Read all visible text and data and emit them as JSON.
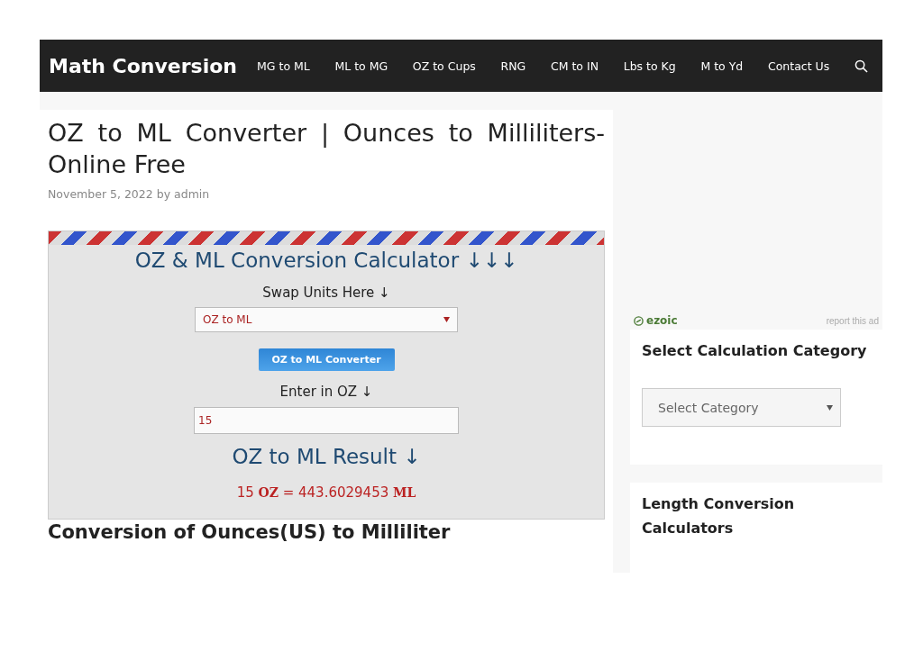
{
  "header": {
    "site_title": "Math Conversion",
    "nav": [
      {
        "label": "MG to ML"
      },
      {
        "label": "ML to MG"
      },
      {
        "label": "OZ to Cups"
      },
      {
        "label": "RNG"
      },
      {
        "label": "CM to IN"
      },
      {
        "label": "Lbs to Kg"
      },
      {
        "label": "M to Yd"
      },
      {
        "label": "Contact Us"
      }
    ]
  },
  "article": {
    "title": "OZ to ML Converter | Ounces to Milliliters-Online Free",
    "date": "November 5, 2022",
    "by": "by",
    "author": "admin",
    "calculator": {
      "heading": "OZ & ML Conversion Calculator ↓↓↓",
      "swap_label": "Swap Units Here ↓",
      "unit_select": {
        "value": "OZ to ML"
      },
      "button": "OZ to ML Converter",
      "input_label": "Enter in OZ ↓",
      "input": {
        "value": "15"
      },
      "result_heading": "OZ to ML Result ↓",
      "result": "15 **OZ** = 443.6029453 **ML**"
    },
    "section_heading": "Conversion of Ounces(US) to Milliliter"
  },
  "sidebar": {
    "ad": {
      "brand": "ezoic",
      "report": "report this ad"
    },
    "widgets": [
      {
        "kind": "select",
        "title": "Select Calculation Category",
        "select": {
          "value": "Select Category"
        }
      },
      {
        "kind": "text",
        "title": "Length Conversion Calculators"
      }
    ]
  }
}
